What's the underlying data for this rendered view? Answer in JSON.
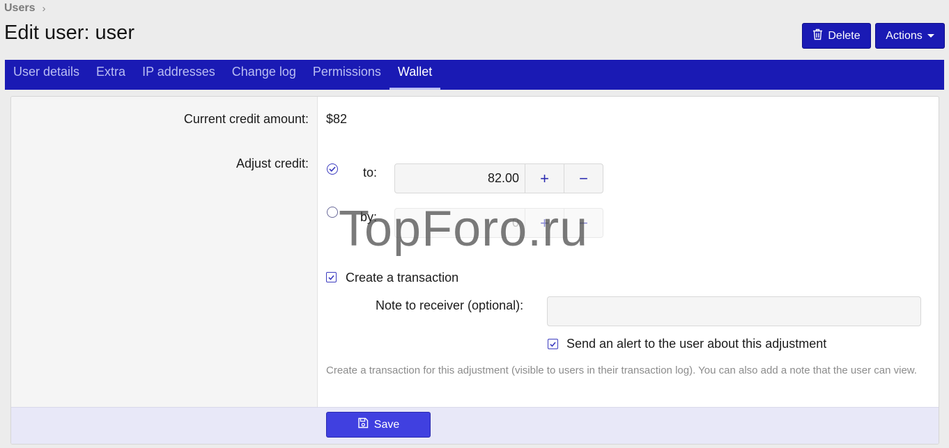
{
  "breadcrumb": {
    "item": "Users",
    "separator": "›"
  },
  "page": {
    "title": "Edit user: user"
  },
  "header_actions": {
    "delete_label": "Delete",
    "actions_label": "Actions"
  },
  "tabs": [
    {
      "label": "User details",
      "active": false
    },
    {
      "label": "Extra",
      "active": false
    },
    {
      "label": "IP addresses",
      "active": false
    },
    {
      "label": "Change log",
      "active": false
    },
    {
      "label": "Permissions",
      "active": false
    },
    {
      "label": "Wallet",
      "active": true
    }
  ],
  "wallet": {
    "current_credit_label": "Current credit amount:",
    "current_credit_value": "$82",
    "adjust_credit_label": "Adjust credit:",
    "to_label": "to:",
    "to_value": "82.00",
    "to_selected": true,
    "by_label": "by:",
    "by_value": "0",
    "by_selected": false,
    "plus_symbol": "+",
    "minus_symbol": "−",
    "create_transaction_label": "Create a transaction",
    "create_transaction_checked": true,
    "note_label": "Note to receiver (optional):",
    "note_value": "",
    "send_alert_label": "Send an alert to the user about this adjustment",
    "send_alert_checked": true,
    "hint": "Create a transaction for this adjustment (visible to users in their transaction log). You can also add a note that the user can view."
  },
  "footer": {
    "save_label": "Save"
  },
  "watermark": "TopForo.ru",
  "colors": {
    "brand": "#1a1ab4",
    "save_button": "#4040e0",
    "tab_inactive": "#b9bdf2",
    "footer_bg": "#e8e8f8"
  },
  "icons": {
    "delete": "trash-icon",
    "actions": "caret-down-icon",
    "save": "floppy-disk-icon",
    "breadcrumb": "chevron-right-icon"
  }
}
